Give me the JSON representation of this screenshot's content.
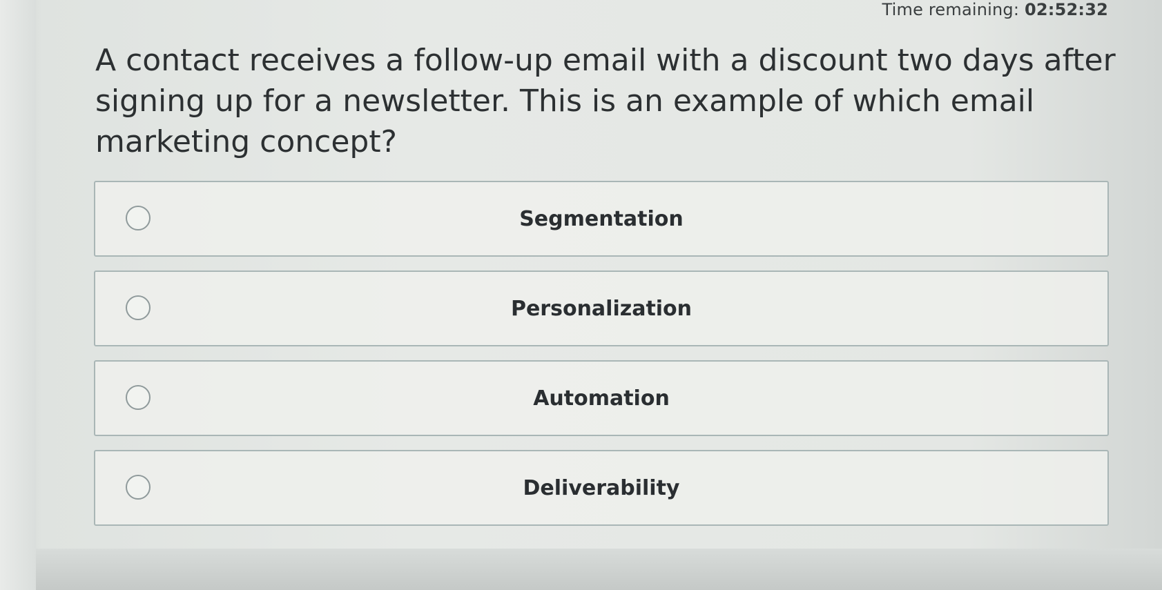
{
  "header": {
    "timer_label": "Time remaining:",
    "timer_value": "02:52:32"
  },
  "question": {
    "text": "A contact receives a follow-up email with a discount two days after signing up for a newsletter. This is an example of which email marketing concept?"
  },
  "options": [
    {
      "label": "Segmentation",
      "selected": false
    },
    {
      "label": "Personalization",
      "selected": false
    },
    {
      "label": "Automation",
      "selected": false
    },
    {
      "label": "Deliverability",
      "selected": false
    }
  ]
}
